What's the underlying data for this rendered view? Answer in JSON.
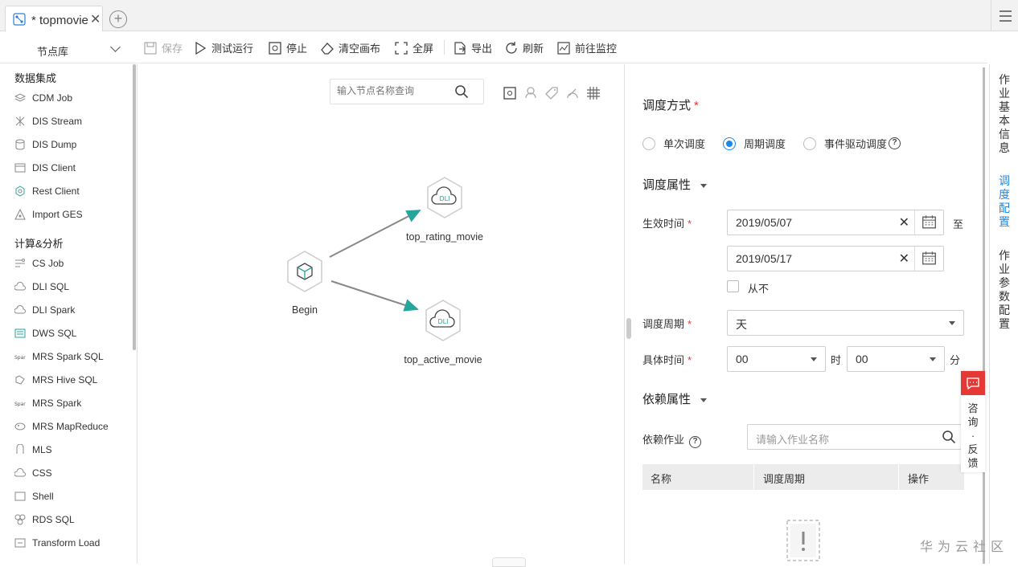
{
  "tab": {
    "title": "* topmovie",
    "close": "✕",
    "add": "+"
  },
  "left": {
    "header": "节点库",
    "groups": [
      {
        "label": "数据集成",
        "items": [
          "CDM Job",
          "DIS Stream",
          "DIS Dump",
          "DIS Client",
          "Rest Client",
          "Import GES"
        ]
      },
      {
        "label": "计算&分析",
        "items": [
          "CS Job",
          "DLI SQL",
          "DLI Spark",
          "DWS SQL",
          "MRS Spark SQL",
          "MRS Hive SQL",
          "MRS Spark",
          "MRS MapReduce",
          "MLS",
          "CSS",
          "Shell",
          "RDS SQL",
          "Transform Load"
        ]
      }
    ]
  },
  "toolbar": {
    "save": "保存",
    "test_run": "测试运行",
    "stop": "停止",
    "clear": "清空画布",
    "fullscreen": "全屏",
    "export": "导出",
    "refresh": "刷新",
    "monitor": "前往监控"
  },
  "canvas": {
    "search_placeholder": "输入节点名称查询",
    "nodes": {
      "begin": "Begin",
      "rating": "top_rating_movie",
      "active": "top_active_movie",
      "dli_badge": "DLI"
    }
  },
  "schedule": {
    "mode_label": "调度方式",
    "modes": [
      "单次调度",
      "周期调度",
      "事件驱动调度"
    ],
    "selected_mode": "周期调度",
    "props_label": "调度属性",
    "effective_label": "生效时间",
    "start_date": "2019/05/07",
    "end_date": "2019/05/17",
    "to": "至",
    "never": "从不",
    "period_label": "调度周期",
    "period_value": "天",
    "time_label": "具体时间",
    "hour": "00",
    "hour_unit": "时",
    "minute": "00",
    "minute_unit": "分",
    "dep_label": "依赖属性",
    "dep_job_label": "依赖作业",
    "dep_placeholder": "请输入作业名称",
    "table_headers": [
      "名称",
      "调度周期",
      "操作"
    ]
  },
  "vtabs": [
    "作业基本信息",
    "调度配置",
    "作业参数配置"
  ],
  "feedback": "咨询·反馈",
  "watermark": "华为云社区",
  "colors": {
    "accent": "#1e88e5",
    "required": "#e53935",
    "node_teal": "#26a69a"
  }
}
